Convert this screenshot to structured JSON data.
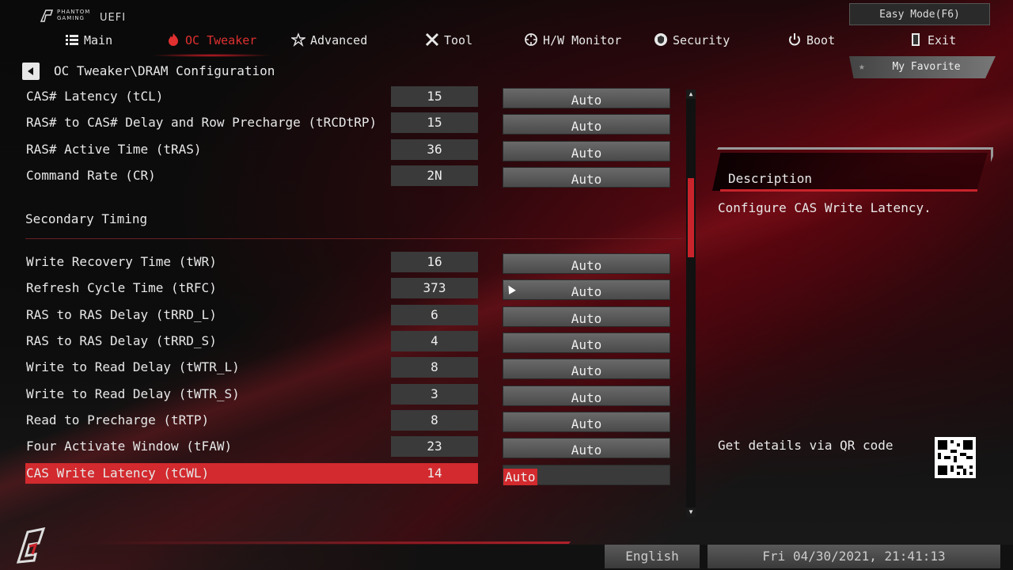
{
  "header": {
    "brand_line1": "PHANTOM",
    "brand_line2": "GAMING",
    "uefi": "UEFI",
    "easy_mode": "Easy Mode(F6)"
  },
  "nav": [
    {
      "label": "Main",
      "icon": "list-icon"
    },
    {
      "label": "OC Tweaker",
      "icon": "flame-icon",
      "active": true
    },
    {
      "label": "Advanced",
      "icon": "star-icon"
    },
    {
      "label": "Tool",
      "icon": "tools-icon"
    },
    {
      "label": "H/W Monitor",
      "icon": "monitor-icon"
    },
    {
      "label": "Security",
      "icon": "shield-icon"
    },
    {
      "label": "Boot",
      "icon": "power-icon"
    },
    {
      "label": "Exit",
      "icon": "exit-door-icon"
    }
  ],
  "breadcrumb": "OC Tweaker\\DRAM Configuration",
  "favorite": "My Favorite",
  "primary_rows": [
    {
      "label": "CAS# Latency (tCL)",
      "value": "15",
      "option": "Auto"
    },
    {
      "label": "RAS# to CAS# Delay and Row Precharge (tRCDtRP)",
      "value": "15",
      "option": "Auto"
    },
    {
      "label": "RAS# Active Time (tRAS)",
      "value": "36",
      "option": "Auto"
    },
    {
      "label": "Command Rate (CR)",
      "value": "2N",
      "option": "Auto"
    }
  ],
  "section_title": "Secondary Timing",
  "secondary_rows": [
    {
      "label": "Write Recovery Time (tWR)",
      "value": "16",
      "option": "Auto"
    },
    {
      "label": "Refresh Cycle Time (tRFC)",
      "value": "373",
      "option": "Auto"
    },
    {
      "label": "RAS to RAS Delay (tRRD_L)",
      "value": "6",
      "option": "Auto"
    },
    {
      "label": "RAS to RAS Delay (tRRD_S)",
      "value": "4",
      "option": "Auto"
    },
    {
      "label": "Write to Read Delay (tWTR_L)",
      "value": "8",
      "option": "Auto"
    },
    {
      "label": "Write to Read Delay (tWTR_S)",
      "value": "3",
      "option": "Auto"
    },
    {
      "label": "Read to Precharge (tRTP)",
      "value": "8",
      "option": "Auto"
    },
    {
      "label": "Four Activate Window (tFAW)",
      "value": "23",
      "option": "Auto"
    },
    {
      "label": "CAS Write Latency (tCWL)",
      "value": "14",
      "option": "Auto",
      "selected": true
    }
  ],
  "description": {
    "title": "Description",
    "text": "Configure CAS Write Latency."
  },
  "qr_label": "Get details via QR code",
  "footer": {
    "language": "English",
    "datetime": "Fri 04/30/2021, 21:41:13"
  },
  "colors": {
    "accent": "#d22a2e",
    "value_bg": "#3a3a3a",
    "option_bg": "#5a5a5a"
  }
}
